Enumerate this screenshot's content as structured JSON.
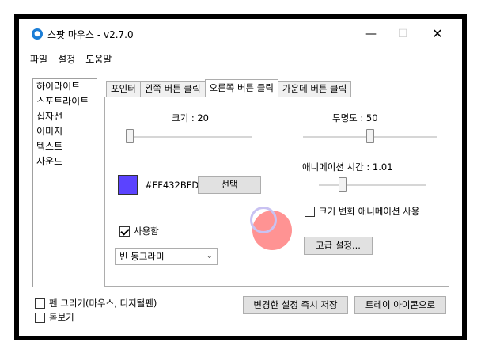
{
  "window": {
    "title": "스팟 마우스 - v2.7.0",
    "icon": "mouse-app-icon",
    "controls": {
      "minimize": "—",
      "maximize": "☐",
      "close": "✕"
    }
  },
  "menu": {
    "items": [
      "파일",
      "설정",
      "도움말"
    ]
  },
  "left_list": {
    "items": [
      "하이라이트",
      "스포트라이트",
      "십자선",
      "이미지",
      "텍스트",
      "사운드"
    ]
  },
  "tabs": {
    "items": [
      "포인터",
      "왼쪽 버튼 클릭",
      "오른쪽 버튼 클릭",
      "가운데 버튼 클릭"
    ],
    "active_index": 2
  },
  "panel": {
    "size_label": "크기 :  20",
    "size_level": 0.0,
    "opacity_label": "투명도 : 50",
    "opacity_level": 0.5,
    "color_hex": "#FF432BFD",
    "color_swatch": "#5b43ff",
    "select_button": "선택",
    "anim_time_label": "애니메이션 시간 : 1.01",
    "anim_time_level": 0.2,
    "size_anim_label": "크기 변화 애니메이션 사용",
    "size_anim_checked": false,
    "use_label": "사용함",
    "use_checked": true,
    "shape_select": "빈 동그라미",
    "advanced_button": "고급 설정..."
  },
  "bottom": {
    "pen_label": "펜 그리기(마우스, 디지털펜)",
    "pen_checked": false,
    "magnifier_label": "돋보기",
    "magnifier_checked": false,
    "apply_button": "변경한 설정 즉시 저장",
    "tray_button": "트레이 아이콘으로"
  },
  "colors": {
    "click_effect": "#ff8080",
    "click_ring": "#c9c2f2",
    "accent_focus": "#0078d7"
  }
}
